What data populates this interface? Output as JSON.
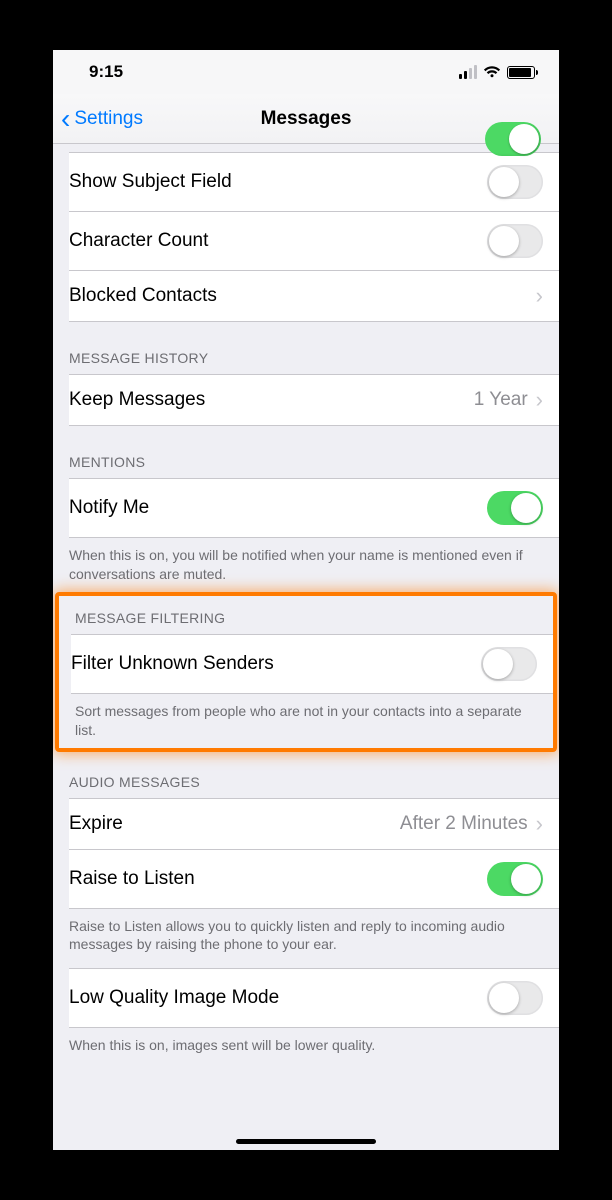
{
  "statusbar": {
    "time": "9:15"
  },
  "navbar": {
    "back_label": "Settings",
    "title": "Messages"
  },
  "rows": {
    "show_subject": "Show Subject Field",
    "char_count": "Character Count",
    "blocked": "Blocked Contacts"
  },
  "sections": {
    "history": {
      "header": "MESSAGE HISTORY",
      "keep_label": "Keep Messages",
      "keep_value": "1 Year"
    },
    "mentions": {
      "header": "MENTIONS",
      "notify_label": "Notify Me",
      "footer": "When this is on, you will be notified when your name is mentioned even if conversations are muted."
    },
    "filtering": {
      "header": "MESSAGE FILTERING",
      "filter_label": "Filter Unknown Senders",
      "footer": "Sort messages from people who are not in your contacts into a separate list."
    },
    "audio": {
      "header": "AUDIO MESSAGES",
      "expire_label": "Expire",
      "expire_value": "After 2 Minutes",
      "raise_label": "Raise to Listen",
      "footer": "Raise to Listen allows you to quickly listen and reply to incoming audio messages by raising the phone to your ear."
    },
    "lowq": {
      "label": "Low Quality Image Mode",
      "footer": "When this is on, images sent will be lower quality."
    }
  },
  "toggles": {
    "show_subject": false,
    "char_count": false,
    "notify_me": true,
    "filter_unknown": false,
    "raise_listen": true,
    "low_quality": false
  },
  "colors": {
    "accent": "#007aff",
    "toggle_on": "#4cd964",
    "highlight": "#ff7a00"
  }
}
